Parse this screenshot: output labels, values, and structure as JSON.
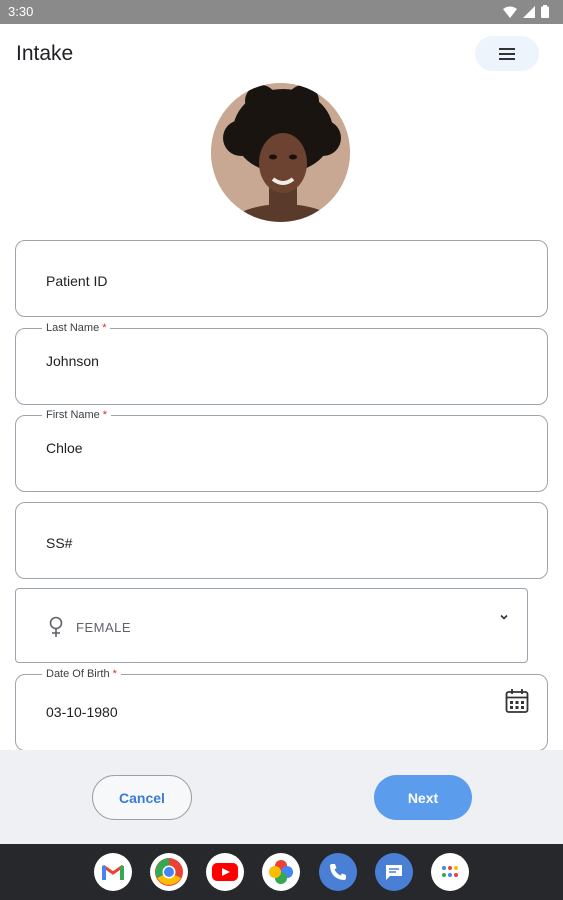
{
  "status_bar": {
    "time": "3:30"
  },
  "header": {
    "title": "Intake",
    "menu_icon": "hamburger-menu-icon"
  },
  "avatar": {
    "alt": "patient-photo"
  },
  "form": {
    "patient_id": {
      "placeholder": "Patient ID"
    },
    "last_name": {
      "label": "Last Name",
      "required_mark": "*",
      "value": "Johnson"
    },
    "first_name": {
      "label": "First Name",
      "required_mark": "*",
      "value": "Chloe"
    },
    "ssn": {
      "placeholder": "SS#"
    },
    "gender": {
      "value": "FEMALE",
      "icon": "female-symbol-icon"
    },
    "dob": {
      "label": "Date Of Birth",
      "required_mark": "*",
      "value": "03-10-1980",
      "icon": "calendar-icon"
    }
  },
  "actions": {
    "cancel_label": "Cancel",
    "next_label": "Next"
  },
  "dock": {
    "apps": [
      "gmail-icon",
      "chrome-icon",
      "youtube-icon",
      "photos-icon",
      "phone-icon",
      "messages-icon",
      "app-drawer-icon"
    ]
  },
  "colors": {
    "accent": "#5c9ced",
    "link": "#3a7bd5",
    "required": "#d32f2f"
  }
}
